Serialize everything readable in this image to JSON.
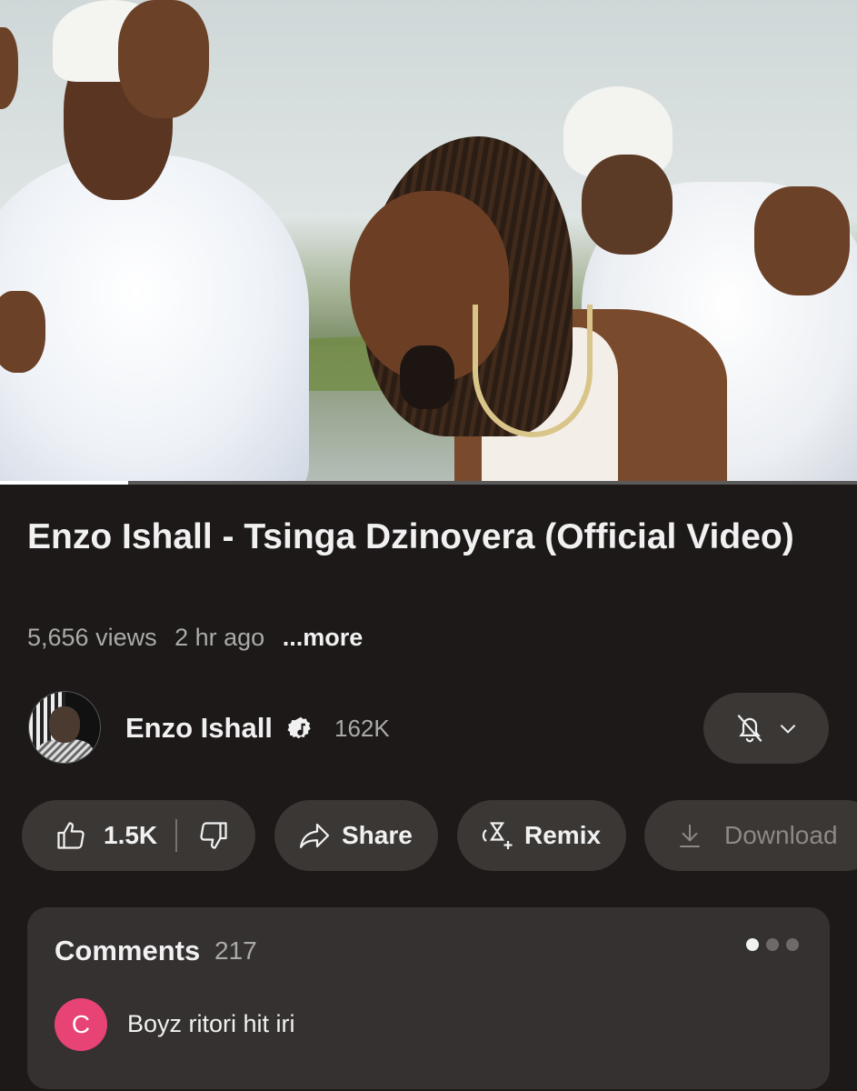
{
  "video": {
    "progress_fraction": 0.15
  },
  "title": "Enzo Ishall - Tsinga Dzinoyera (Official Video)",
  "meta": {
    "views": "5,656 views",
    "age": "2 hr ago",
    "more": "...more"
  },
  "channel": {
    "name": "Enzo Ishall",
    "subscribers": "162K",
    "verified_icon": "verified-music-icon",
    "bell_icon": "bell-off-icon"
  },
  "actions": {
    "like_count": "1.5K",
    "share_label": "Share",
    "remix_label": "Remix",
    "download_label": "Download"
  },
  "comments": {
    "title": "Comments",
    "count": "217",
    "first": {
      "avatar_letter": "C",
      "avatar_color": "#e84375",
      "text": "Boyz ritori hit iri"
    }
  },
  "colors": {
    "background": "#1c1918",
    "chip": "#3a3735",
    "panel": "#343130",
    "secondary_text": "#aaaaaa"
  }
}
